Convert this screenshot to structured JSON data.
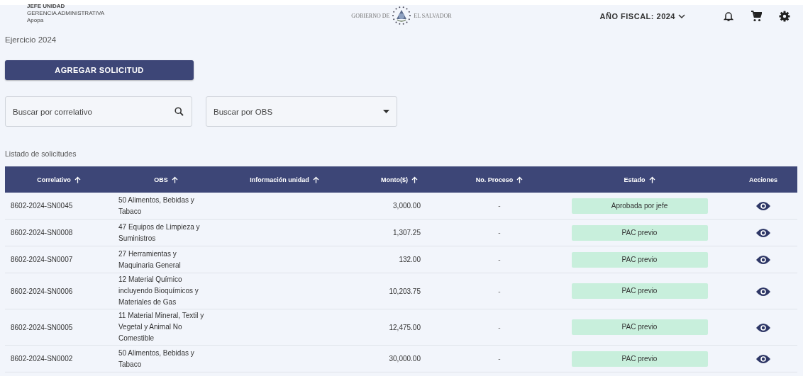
{
  "user": {
    "role": "JEFE UNIDAD",
    "department": "GERENCIA ADMINISTRATIVA",
    "location": "Apopa"
  },
  "logo": {
    "left": "GOBIERNO DE",
    "right": "EL SALVADOR"
  },
  "fiscal_year": {
    "label": "AÑO FISCAL: 2024"
  },
  "exercise": "Ejercicio 2024",
  "add_button": "AGREGAR SOLICITUD",
  "search": {
    "placeholder": "Buscar por correlativo"
  },
  "obs_filter": {
    "placeholder": "Buscar por OBS"
  },
  "list_title": "Listado de solicitudes",
  "table": {
    "columns": [
      {
        "label": "Correlativo",
        "sortable": true
      },
      {
        "label": "OBS",
        "sortable": true
      },
      {
        "label": "Información unidad",
        "sortable": true
      },
      {
        "label": "Monto($)",
        "sortable": true
      },
      {
        "label": "No. Proceso",
        "sortable": true
      },
      {
        "label": "Estado",
        "sortable": true
      },
      {
        "label": "Acciones",
        "sortable": false
      }
    ],
    "rows": [
      {
        "correlativo": "8602-2024-SN0045",
        "obs": "50 Alimentos, Bebidas y\nTabaco",
        "monto": "3,000.00",
        "proceso": "-",
        "estado": "Aprobada por jefe"
      },
      {
        "correlativo": "8602-2024-SN0008",
        "obs": "47 Equipos de Limpieza y\nSuministros",
        "monto": "1,307.25",
        "proceso": "-",
        "estado": "PAC previo"
      },
      {
        "correlativo": "8602-2024-SN0007",
        "obs": "27 Herramientas y\nMaquinaria General",
        "monto": "132.00",
        "proceso": "-",
        "estado": "PAC previo"
      },
      {
        "correlativo": "8602-2024-SN0006",
        "obs": "12 Material Químico\nincluyendo Bioquímicos y\nMateriales de Gas",
        "monto": "10,203.75",
        "proceso": "-",
        "estado": "PAC previo"
      },
      {
        "correlativo": "8602-2024-SN0005",
        "obs": "11 Material Mineral, Textil y\nVegetal y Animal No\nComestible",
        "monto": "12,475.00",
        "proceso": "-",
        "estado": "PAC previo"
      },
      {
        "correlativo": "8602-2024-SN0002",
        "obs": "50 Alimentos, Bebidas y\nTabaco",
        "monto": "30,000.00",
        "proceso": "-",
        "estado": "PAC previo"
      }
    ]
  }
}
